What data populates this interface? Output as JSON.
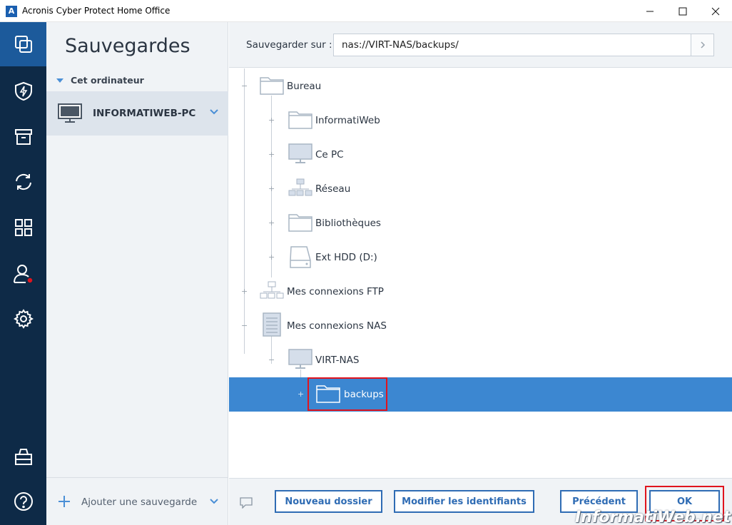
{
  "window": {
    "title": "Acronis Cyber Protect Home Office",
    "app_icon_letter": "A"
  },
  "nav": {
    "items": [
      {
        "name": "backup",
        "icon": "copy-icon",
        "active": true
      },
      {
        "name": "protection",
        "icon": "shield-icon"
      },
      {
        "name": "archive",
        "icon": "archive-box-icon"
      },
      {
        "name": "sync",
        "icon": "sync-icon"
      },
      {
        "name": "tools",
        "icon": "grid-icon"
      },
      {
        "name": "account",
        "icon": "user-icon"
      },
      {
        "name": "settings",
        "icon": "gear-icon"
      },
      {
        "name": "store",
        "icon": "shop-bag-icon"
      },
      {
        "name": "help",
        "icon": "help-icon"
      }
    ],
    "notification_color": "#e0141e"
  },
  "sidebar": {
    "title": "Sauvegardes",
    "group_label": "Cet ordinateur",
    "computer_name": "INFORMATIWEB-PC",
    "add_backup_label": "Ajouter une sauvegarde"
  },
  "destination": {
    "label": "Sauvegarder sur :",
    "path": "nas://VIRT-NAS/backups/"
  },
  "tree": {
    "items": [
      {
        "label": "Bureau",
        "icon": "folder-icon"
      },
      {
        "label": "InformatiWeb",
        "icon": "folder-icon"
      },
      {
        "label": "Ce PC",
        "icon": "monitor-icon"
      },
      {
        "label": "Réseau",
        "icon": "network-icon"
      },
      {
        "label": "Bibliothèques",
        "icon": "folder-icon"
      },
      {
        "label": "Ext HDD (D:)",
        "icon": "drive-icon"
      },
      {
        "label": "Mes connexions FTP",
        "icon": "network-icon"
      },
      {
        "label": "Mes connexions NAS",
        "icon": "server-icon"
      },
      {
        "label": "VIRT-NAS",
        "icon": "monitor-icon"
      },
      {
        "label": "backups",
        "icon": "folder-icon",
        "selected": true
      }
    ]
  },
  "buttons": {
    "new_folder": "Nouveau dossier",
    "edit_credentials": "Modifier les identifiants",
    "previous": "Précédent",
    "ok": "OK"
  },
  "watermark": "InformatiWeb.net",
  "colors": {
    "nav_bg": "#0e2a47",
    "nav_active": "#1c5a9b",
    "selection": "#3c87d1",
    "button_blue": "#2f6cb4",
    "highlight_red": "#e0141e"
  }
}
